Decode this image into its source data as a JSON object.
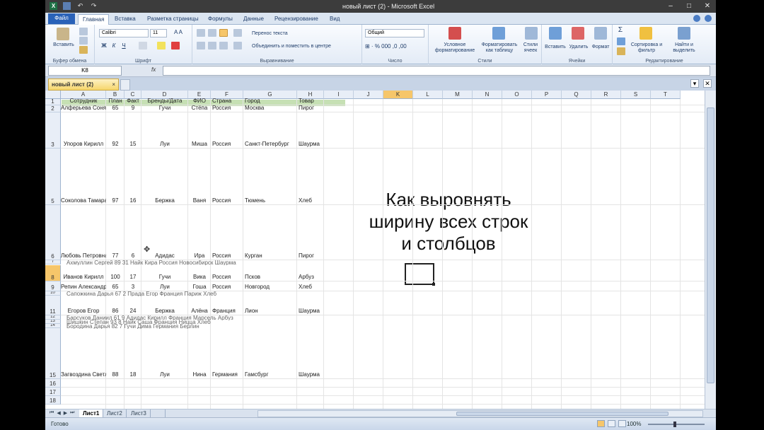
{
  "window": {
    "title": "новый лист (2) - Microsoft Excel"
  },
  "ribbon_tabs": [
    "Файл",
    "Главная",
    "Вставка",
    "Разметка страницы",
    "Формулы",
    "Данные",
    "Рецензирование",
    "Вид"
  ],
  "ribbon": {
    "paste": "Вставить",
    "font_name": "Calibri",
    "font_size": "11",
    "bold": "Ж",
    "italic": "К",
    "underline": "Ч",
    "wrap_text": "Перенос текста",
    "merge_center": "Объединить и поместить в центре",
    "number_format": "Общий",
    "conditional_format": "Условное форматирование",
    "format_as_table": "Форматировать как таблицу",
    "cell_styles": "Стили ячеек",
    "insert": "Вставить",
    "delete": "Удалить",
    "format": "Формат",
    "sort_filter": "Сортировка и фильтр",
    "find_select": "Найти и выделить",
    "groups": {
      "clipboard": "Буфер обмена",
      "font": "Шрифт",
      "alignment": "Выравнивание",
      "number": "Число",
      "styles": "Стили",
      "cells": "Ячейки",
      "editing": "Редактирование"
    }
  },
  "formula_bar": {
    "name_box": "K8",
    "fx": "fx",
    "value": ""
  },
  "workbook_tab": {
    "name": "новый лист (2)",
    "close": "×"
  },
  "columns": [
    "A",
    "B",
    "C",
    "D",
    "E",
    "F",
    "G",
    "H",
    "I",
    "J",
    "K",
    "L",
    "M",
    "N",
    "O",
    "P",
    "Q",
    "R",
    "S",
    "T"
  ],
  "selected_column": "K",
  "selected_row": "8",
  "header_row": [
    "Сотрудник",
    "План",
    "Факт",
    "Бренды/Дата",
    "ФИО",
    "Страна",
    "Город",
    "Товар"
  ],
  "visible_rows": [
    {
      "num": "1",
      "cells": [
        "Сотрудник",
        "План",
        "Факт",
        "Бренды/Дата",
        "ФИО",
        "Страна",
        "Город",
        "Товар"
      ]
    },
    {
      "num": "2",
      "cells": [
        "Алферьева Соня",
        "65",
        "9",
        "Гучи",
        "Стёпа",
        "Россия",
        "Москва",
        "Пирог"
      ]
    },
    {
      "num": "3",
      "cells": [
        "Упоров Кирилл",
        "92",
        "15",
        "Луи",
        "Миша",
        "Россия",
        "Санкт-Петербург",
        "Шаурма"
      ]
    },
    {
      "num": "5",
      "cells": [
        "Соколова Тамара",
        "97",
        "16",
        "Бержка",
        "Ваня",
        "Россия",
        "Тюмень",
        "Хлеб"
      ]
    },
    {
      "num": "6",
      "cells": [
        "Любовь Петровна",
        "77",
        "6",
        "Адидас",
        "Ира",
        "Россия",
        "Курган",
        "Пирог"
      ]
    },
    {
      "num": "8",
      "cells": [
        "Иванов Кирилл",
        "100",
        "17",
        "Гучи",
        "Вика",
        "Россия",
        "Псков",
        "Арбуз"
      ]
    },
    {
      "num": "9",
      "cells": [
        "Репин Александр",
        "65",
        "3",
        "Луи",
        "Гоша",
        "Россия",
        "Новгород",
        "Хлеб"
      ]
    },
    {
      "num": "11",
      "cells": [
        "Егоров Егор",
        "86",
        "24",
        "Бержка",
        "Алёна",
        "Франция",
        "Лион",
        "Шаурма"
      ]
    },
    {
      "num": "15",
      "cells": [
        "Загвоздина Светлана",
        "88",
        "18",
        "Луи",
        "Нина",
        "Германия",
        "Гамсбург",
        "Шаурма"
      ]
    },
    {
      "num": "16",
      "cells": []
    },
    {
      "num": "17",
      "cells": []
    },
    {
      "num": "18",
      "cells": []
    }
  ],
  "ghost_rows": [
    {
      "num": "7",
      "text": "Ахмуллин Сергей     89    31        Найк       Кира    Россия     Новосибирск      Шаурма"
    },
    {
      "num": "10",
      "text": "Сапожкина Дарья     67    2       Прада       Егор    Франция    Париж           Хлеб"
    },
    {
      "num": "12",
      "text": "Барсуков Даниил     61    9      Адидас     Кирилл   Франция    Марсель          Арбуз"
    },
    {
      "num": "13",
      "text": "Шишкин Степан       93    8        Найк       Саша    Франция    Ницца            Хлеб"
    },
    {
      "num": "14",
      "text": "Бородина Дарья      82    7        Гучи       Дима    Германия   Берлин"
    }
  ],
  "overlay_lines": [
    "Как выровнять",
    "ширину всех строк",
    "и столбцов"
  ],
  "sheet_tabs": [
    "Лист1",
    "Лист2",
    "Лист3"
  ],
  "status": {
    "ready": "Готово",
    "zoom": "100%"
  },
  "colors": {
    "accent": "#2a62b8",
    "selected_header": "#f6c66a",
    "header_fill": "#c6e0b4"
  }
}
